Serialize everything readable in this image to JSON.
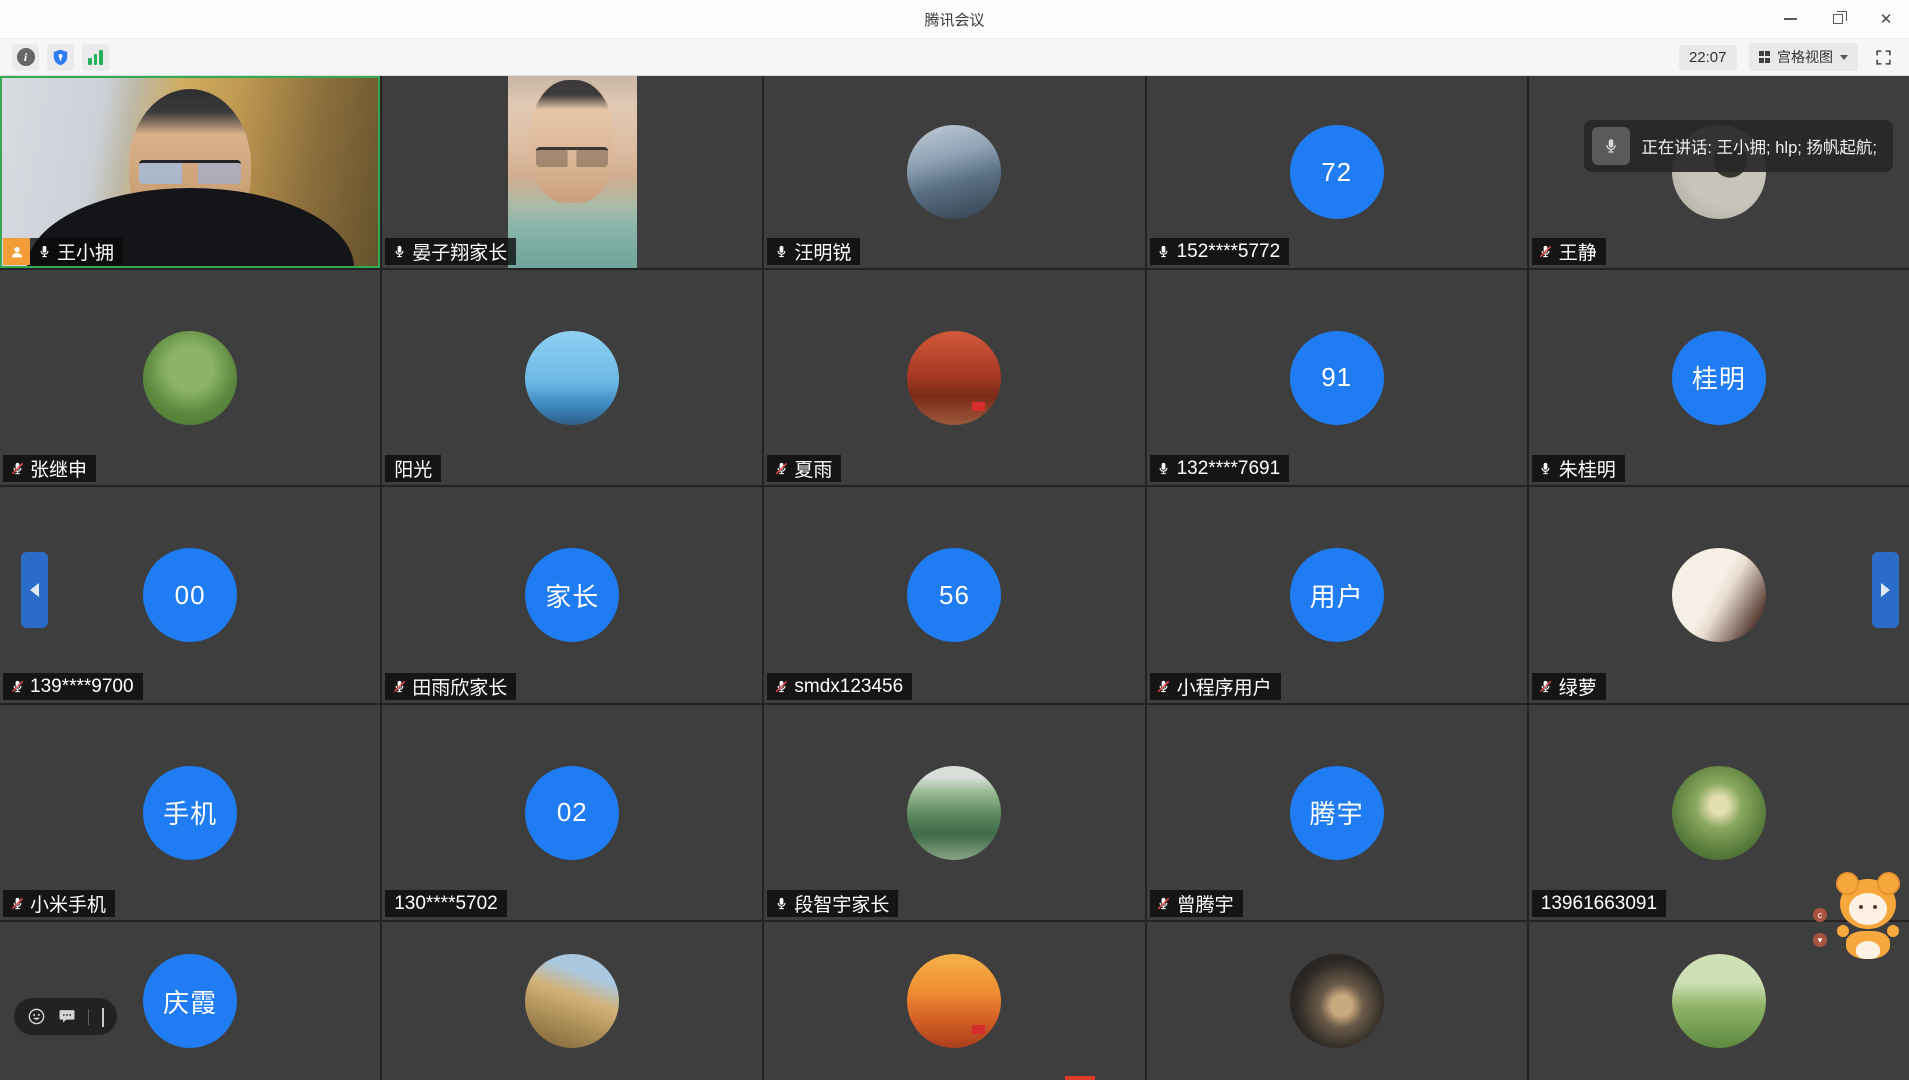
{
  "window": {
    "title": "腾讯会议",
    "controls": {
      "minimize": "minimize-icon",
      "restore": "restore-icon",
      "close": "close-icon"
    }
  },
  "toolbar": {
    "left_icons": [
      "meeting-info-icon",
      "security-shield-icon",
      "network-signal-icon"
    ],
    "time": "22:07",
    "view": {
      "label": "宫格视图",
      "icon": "grid-view-icon",
      "caret": "chevron-down-icon"
    },
    "fullscreen_icon": "fullscreen-icon"
  },
  "toast": {
    "icon": "microphone-icon",
    "text": "正在讲话: 王小拥; hlp; 扬帆起航;"
  },
  "quickbar": {
    "icons": [
      "emoji-reaction-icon",
      "chat-bubble-icon",
      "collapse-chevron-icon"
    ]
  },
  "nav": {
    "prev": "chevron-left-icon",
    "next": "chevron-right-icon"
  },
  "colors": {
    "accent_blue": "#1f7cf2",
    "muted_red": "#e5484d",
    "active_green": "#35a854",
    "host_orange": "#f29d38",
    "nav_blue": "#2b6cc8"
  },
  "grid": {
    "columns": 5,
    "cells": [
      {
        "name": "王小拥",
        "mic": "on",
        "host": true,
        "active": true,
        "avatar": {
          "kind": "video",
          "video": "man"
        }
      },
      {
        "name": "晏子翔家长",
        "mic": "on",
        "avatar": {
          "kind": "video",
          "video": "woman"
        }
      },
      {
        "name": "汪明锐",
        "mic": "on",
        "avatar": {
          "kind": "photo",
          "photo": "harbor"
        }
      },
      {
        "name": "152****5772",
        "mic": "on",
        "avatar": {
          "kind": "text",
          "text": "72"
        }
      },
      {
        "name": "王静",
        "mic": "muted",
        "avatar": {
          "kind": "photo",
          "photo": "plant"
        }
      },
      {
        "name": "张继申",
        "mic": "muted",
        "avatar": {
          "kind": "photo",
          "photo": "park"
        }
      },
      {
        "name": "阳光",
        "mic": "none",
        "avatar": {
          "kind": "photo",
          "photo": "sun"
        }
      },
      {
        "name": "夏雨",
        "mic": "muted",
        "avatar": {
          "kind": "photo",
          "photo": "autumn"
        }
      },
      {
        "name": "132****7691",
        "mic": "on",
        "avatar": {
          "kind": "text",
          "text": "91"
        }
      },
      {
        "name": "朱桂明",
        "mic": "on",
        "avatar": {
          "kind": "text",
          "text": "桂明"
        }
      },
      {
        "name": "139****9700",
        "mic": "muted",
        "avatar": {
          "kind": "text",
          "text": "00"
        }
      },
      {
        "name": "田雨欣家长",
        "mic": "muted",
        "avatar": {
          "kind": "text",
          "text": "家长"
        }
      },
      {
        "name": "smdx123456",
        "mic": "muted",
        "avatar": {
          "kind": "text",
          "text": "56"
        }
      },
      {
        "name": "小程序用户",
        "mic": "muted",
        "avatar": {
          "kind": "text",
          "text": "用户"
        }
      },
      {
        "name": "绿萝",
        "mic": "muted",
        "avatar": {
          "kind": "photo",
          "photo": "anime"
        }
      },
      {
        "name": "小米手机",
        "mic": "muted",
        "avatar": {
          "kind": "text",
          "text": "手机"
        }
      },
      {
        "name": "130****5702",
        "mic": "none",
        "avatar": {
          "kind": "text",
          "text": "02"
        }
      },
      {
        "name": "段智宇家长",
        "mic": "on",
        "avatar": {
          "kind": "photo",
          "photo": "guilin"
        }
      },
      {
        "name": "曾腾宇",
        "mic": "muted",
        "avatar": {
          "kind": "text",
          "text": "腾宇"
        }
      },
      {
        "name": "13961663091",
        "mic": "none",
        "avatar": {
          "kind": "photo",
          "photo": "forest"
        }
      },
      {
        "name": "庆霞",
        "label": false,
        "mic": "none",
        "avatar": {
          "kind": "text",
          "text": "庆霞"
        }
      },
      {
        "name": "",
        "label": false,
        "mic": "none",
        "avatar": {
          "kind": "photo",
          "photo": "rock"
        }
      },
      {
        "name": "",
        "label": false,
        "mic": "none",
        "avatar": {
          "kind": "photo",
          "photo": "sunset"
        }
      },
      {
        "name": "",
        "label": false,
        "mic": "none",
        "avatar": {
          "kind": "photo",
          "photo": "desk"
        }
      },
      {
        "name": "",
        "label": false,
        "mic": "none",
        "avatar": {
          "kind": "photo",
          "photo": "field"
        }
      }
    ]
  }
}
